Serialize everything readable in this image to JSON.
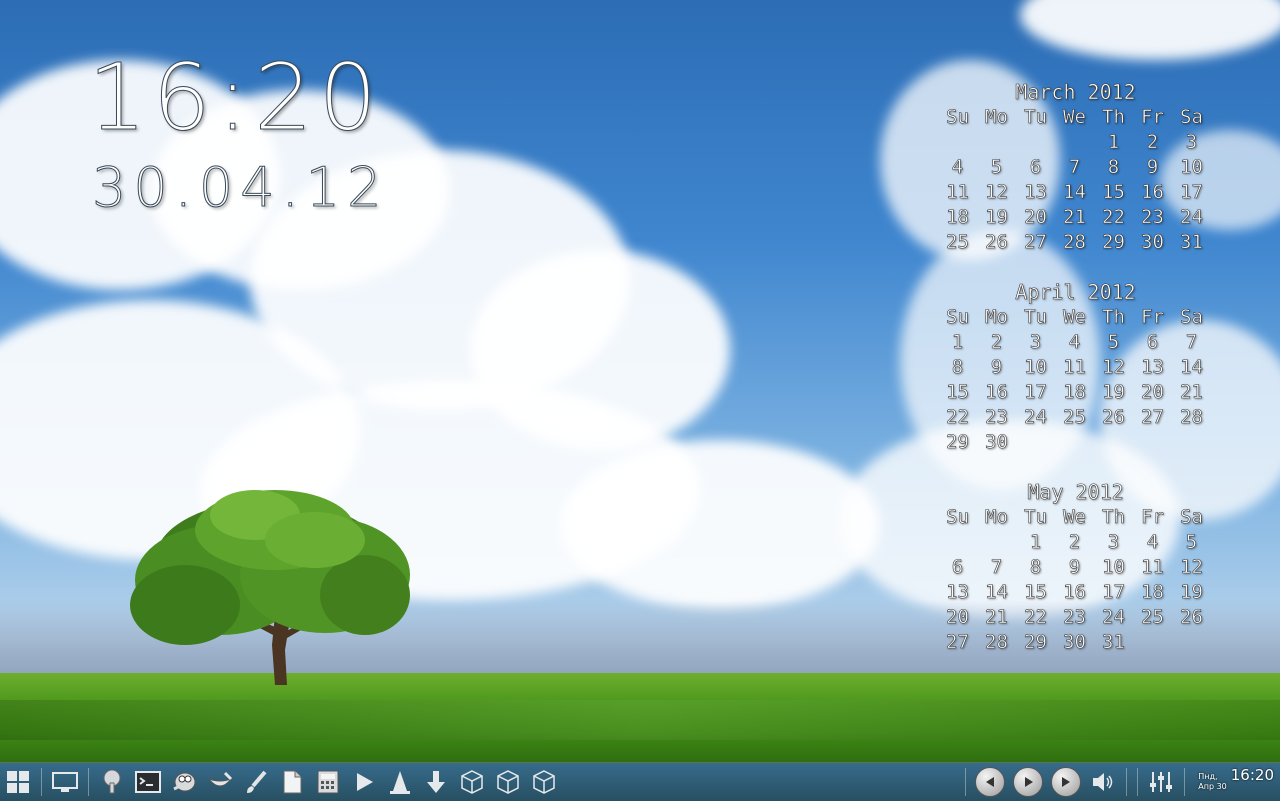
{
  "clock": {
    "time": "16:20",
    "date": "30.04.12"
  },
  "calendars": [
    {
      "title": "March 2012",
      "weekdays": [
        "Su",
        "Mo",
        "Tu",
        "We",
        "Th",
        "Fr",
        "Sa"
      ],
      "weeks": [
        [
          "",
          "",
          "",
          "",
          "1",
          "2",
          "3"
        ],
        [
          "4",
          "5",
          "6",
          "7",
          "8",
          "9",
          "10"
        ],
        [
          "11",
          "12",
          "13",
          "14",
          "15",
          "16",
          "17"
        ],
        [
          "18",
          "19",
          "20",
          "21",
          "22",
          "23",
          "24"
        ],
        [
          "25",
          "26",
          "27",
          "28",
          "29",
          "30",
          "31"
        ]
      ]
    },
    {
      "title": "April 2012",
      "weekdays": [
        "Su",
        "Mo",
        "Tu",
        "We",
        "Th",
        "Fr",
        "Sa"
      ],
      "weeks": [
        [
          "1",
          "2",
          "3",
          "4",
          "5",
          "6",
          "7"
        ],
        [
          "8",
          "9",
          "10",
          "11",
          "12",
          "13",
          "14"
        ],
        [
          "15",
          "16",
          "17",
          "18",
          "19",
          "20",
          "21"
        ],
        [
          "22",
          "23",
          "24",
          "25",
          "26",
          "27",
          "28"
        ],
        [
          "29",
          "30",
          "",
          "",
          "",
          "",
          ""
        ]
      ]
    },
    {
      "title": "May 2012",
      "weekdays": [
        "Su",
        "Mo",
        "Tu",
        "We",
        "Th",
        "Fr",
        "Sa"
      ],
      "weeks": [
        [
          "",
          "",
          "1",
          "2",
          "3",
          "4",
          "5"
        ],
        [
          "6",
          "7",
          "8",
          "9",
          "10",
          "11",
          "12"
        ],
        [
          "13",
          "14",
          "15",
          "16",
          "17",
          "18",
          "19"
        ],
        [
          "20",
          "21",
          "22",
          "23",
          "24",
          "25",
          "26"
        ],
        [
          "27",
          "28",
          "29",
          "30",
          "31",
          "",
          ""
        ]
      ]
    }
  ],
  "taskbar": {
    "launchers": [
      {
        "name": "app-menu-icon",
        "glyph": "grid"
      },
      {
        "name": "show-desktop-icon",
        "glyph": "monitor"
      },
      {
        "name": "system-tool-icon",
        "glyph": "gear-tree"
      },
      {
        "name": "terminal-icon",
        "glyph": "terminal"
      },
      {
        "name": "gimp-icon",
        "glyph": "gimp"
      },
      {
        "name": "inkscape-icon",
        "glyph": "bowl"
      },
      {
        "name": "brush-icon",
        "glyph": "brush"
      },
      {
        "name": "document-icon",
        "glyph": "doc"
      },
      {
        "name": "calculator-icon",
        "glyph": "calc"
      },
      {
        "name": "media-player-icon",
        "glyph": "play"
      },
      {
        "name": "vlc-icon",
        "glyph": "cone"
      },
      {
        "name": "download-icon",
        "glyph": "down"
      },
      {
        "name": "cube-icon-1",
        "glyph": "cube"
      },
      {
        "name": "cube-icon-2",
        "glyph": "cube"
      },
      {
        "name": "cube-icon-3",
        "glyph": "cube"
      }
    ],
    "media": {
      "prev": "◀",
      "play": "▶",
      "next": "▶▶"
    },
    "tray": {
      "day": "Пнд,",
      "date": "Апр 30",
      "time": "16:20"
    }
  }
}
